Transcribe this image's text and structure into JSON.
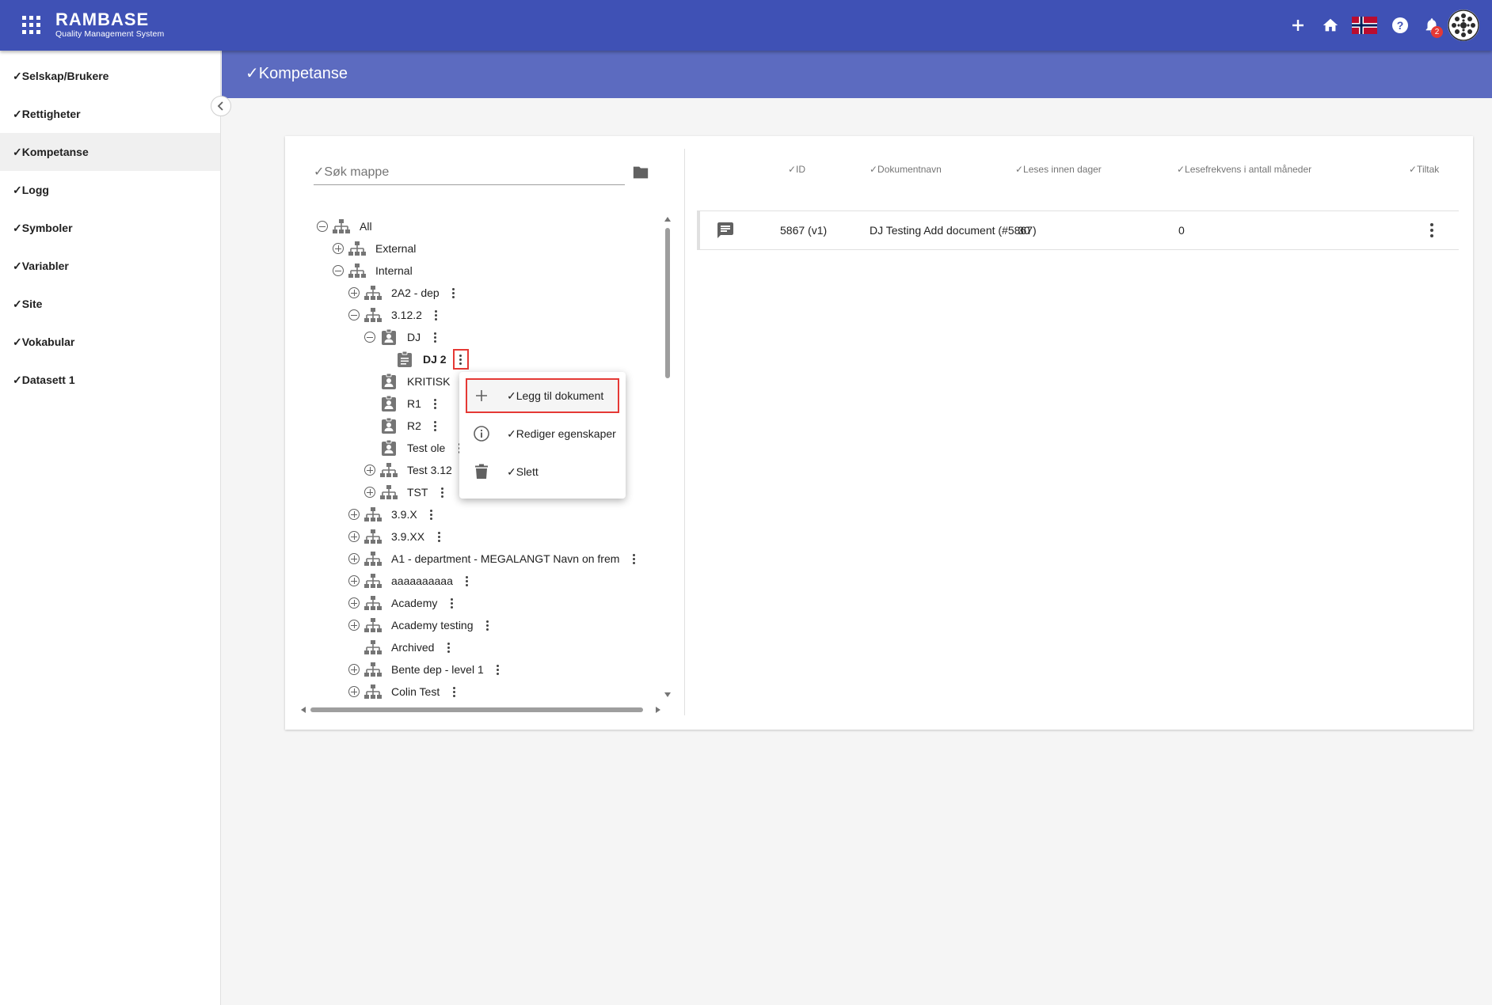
{
  "app": {
    "brand": "RAMBASE",
    "subtitle": "Quality Management System",
    "flag": "Norway",
    "notification_count": "2",
    "colors": {
      "primary": "#3f51b5",
      "header": "#5c6bc0",
      "highlight": "#e53935"
    }
  },
  "sidebar": {
    "items": [
      {
        "label": "✓Selskap/Brukere"
      },
      {
        "label": "✓Rettigheter"
      },
      {
        "label": "✓Kompetanse",
        "active": true
      },
      {
        "label": "✓Logg"
      },
      {
        "label": "✓Symboler"
      },
      {
        "label": "✓Variabler"
      },
      {
        "label": "✓Site"
      },
      {
        "label": "✓Vokabular"
      },
      {
        "label": "✓Datasett 1"
      }
    ]
  },
  "page": {
    "title": "✓Kompetanse"
  },
  "tree": {
    "search_placeholder": "✓Søk mappe",
    "nodes": [
      {
        "label": "All",
        "icon": "org-chart-icon",
        "toggle": "minus"
      },
      {
        "label": "External",
        "icon": "org-chart-icon",
        "toggle": "plus"
      },
      {
        "label": "Internal",
        "icon": "org-chart-icon",
        "toggle": "minus"
      },
      {
        "label": "2A2 - dep",
        "icon": "org-chart-icon",
        "toggle": "plus"
      },
      {
        "label": "3.12.2",
        "icon": "org-chart-icon",
        "toggle": "minus"
      },
      {
        "label": "DJ",
        "icon": "badge-icon",
        "toggle": "minus"
      },
      {
        "label": "DJ 2",
        "icon": "clipboard-icon",
        "toggle": "none",
        "selected": true
      },
      {
        "label": "KRITISK",
        "icon": "badge-icon",
        "toggle": "none"
      },
      {
        "label": "R1",
        "icon": "badge-icon",
        "toggle": "none"
      },
      {
        "label": "R2",
        "icon": "badge-icon",
        "toggle": "none"
      },
      {
        "label": "Test ole",
        "icon": "badge-icon",
        "toggle": "none"
      },
      {
        "label": "Test 3.12",
        "icon": "org-chart-icon",
        "toggle": "plus"
      },
      {
        "label": "TST",
        "icon": "org-chart-icon",
        "toggle": "plus"
      },
      {
        "label": "3.9.X",
        "icon": "org-chart-icon",
        "toggle": "plus"
      },
      {
        "label": "3.9.XX",
        "icon": "org-chart-icon",
        "toggle": "plus"
      },
      {
        "label": "A1 - department - MEGALANGT Navn on frem",
        "icon": "org-chart-icon",
        "toggle": "plus"
      },
      {
        "label": "aaaaaaaaaa",
        "icon": "org-chart-icon",
        "toggle": "plus"
      },
      {
        "label": "Academy",
        "icon": "org-chart-icon",
        "toggle": "plus"
      },
      {
        "label": "Academy testing",
        "icon": "org-chart-icon",
        "toggle": "plus"
      },
      {
        "label": "Archived",
        "icon": "org-chart-icon",
        "toggle": "none"
      },
      {
        "label": "Bente dep - level 1",
        "icon": "org-chart-icon",
        "toggle": "plus"
      },
      {
        "label": "Colin Test",
        "icon": "org-chart-icon",
        "toggle": "plus"
      }
    ]
  },
  "context_menu": {
    "items": [
      {
        "label": "✓Legg til dokument",
        "icon": "plus-icon"
      },
      {
        "label": "✓Rediger egenskaper",
        "icon": "info-icon"
      },
      {
        "label": "✓Slett",
        "icon": "trash-icon"
      }
    ]
  },
  "table": {
    "headers": {
      "id": "✓ID",
      "name": "✓Dokumentnavn",
      "days": "✓Leses innen dager",
      "freq": "✓Lesefrekvens i antall måneder",
      "action": "✓Tiltak"
    },
    "rows": [
      {
        "id": "5867 (v1)",
        "name": "DJ Testing Add document (#5867)",
        "days": "30",
        "freq": "0"
      }
    ]
  }
}
